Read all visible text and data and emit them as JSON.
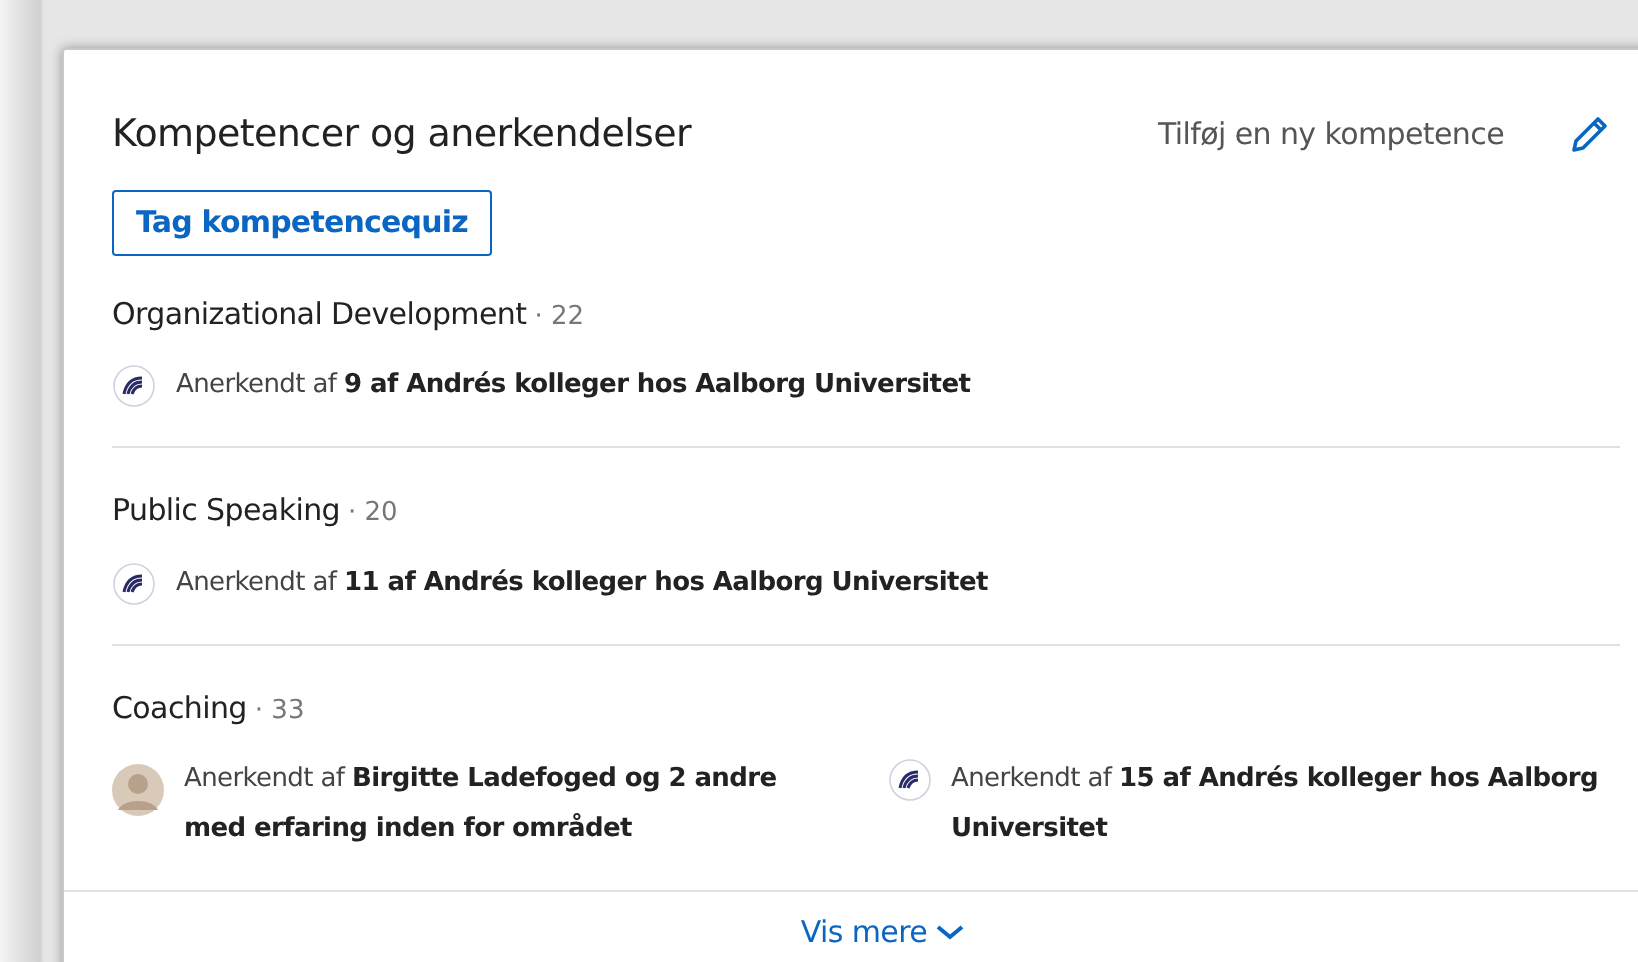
{
  "section": {
    "title": "Kompetencer og anerkendelser",
    "add_link": "Tilføj en ny kompetence",
    "quiz_button": "Tag kompetencequiz"
  },
  "skills": [
    {
      "name": "Organizational Development",
      "count": "· 22",
      "endorsements": [
        {
          "kind": "organization",
          "text": "Anerkendt af **9 af Andrés kolleger hos Aalborg Universitet**"
        }
      ]
    },
    {
      "name": "Public Speaking",
      "count": "· 20",
      "endorsements": [
        {
          "kind": "organization",
          "text": "Anerkendt af **11 af Andrés kolleger hos Aalborg Universitet**"
        }
      ]
    },
    {
      "name": "Coaching",
      "count": "· 33",
      "endorsements": [
        {
          "kind": "person",
          "text": "Anerkendt af **Birgitte Ladefoged og 2 andre med erfaring inden for området**"
        },
        {
          "kind": "organization",
          "text": "Anerkendt af **15 af Andrés kolleger hos Aalborg Universitet**"
        }
      ]
    }
  ],
  "show_more": "Vis mere"
}
